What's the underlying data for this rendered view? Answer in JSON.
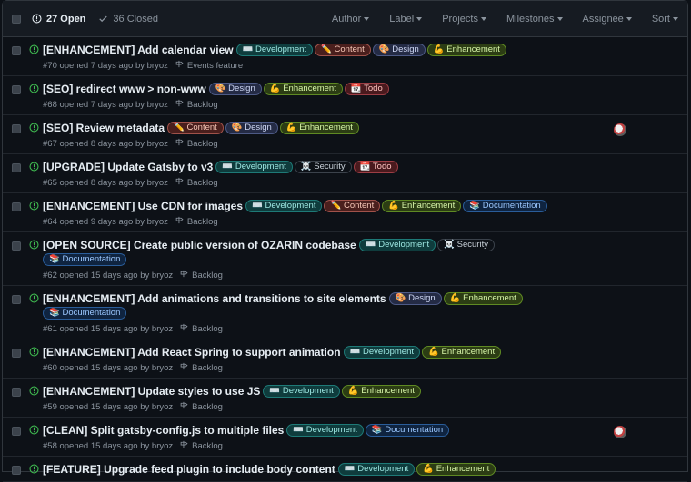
{
  "header": {
    "open_label": "27 Open",
    "closed_label": "36 Closed",
    "filters": [
      "Author",
      "Label",
      "Projects",
      "Milestones",
      "Assignee",
      "Sort"
    ]
  },
  "issues": [
    {
      "title": "[ENHANCEMENT] Add calendar view",
      "meta": "#70 opened 7 days ago by bryoz",
      "milestone": "Events feature",
      "labels": [
        [
          "development",
          "⌨️ Development"
        ],
        [
          "content",
          "✏️ Content"
        ],
        [
          "design",
          "🎨 Design"
        ],
        [
          "enhancement",
          "💪 Enhancement"
        ]
      ],
      "avatar": false
    },
    {
      "title": "[SEO] redirect www > non-www",
      "meta": "#68 opened 7 days ago by bryoz",
      "milestone": "Backlog",
      "labels": [
        [
          "design",
          "🎨 Design"
        ],
        [
          "enhancement",
          "💪 Enhancement"
        ],
        [
          "todo",
          "📆 Todo"
        ]
      ],
      "avatar": false
    },
    {
      "title": "[SEO] Review metadata",
      "meta": "#67 opened 8 days ago by bryoz",
      "milestone": "Backlog",
      "labels": [
        [
          "content",
          "✏️ Content"
        ],
        [
          "design",
          "🎨 Design"
        ],
        [
          "enhancement",
          "💪 Enhancement"
        ]
      ],
      "avatar": true
    },
    {
      "title": "[UPGRADE] Update Gatsby to v3",
      "meta": "#65 opened 8 days ago by bryoz",
      "milestone": "Backlog",
      "labels": [
        [
          "development",
          "⌨️ Development"
        ],
        [
          "security",
          "☠️ Security"
        ],
        [
          "todo",
          "📆 Todo"
        ]
      ],
      "avatar": false
    },
    {
      "title": "[ENHANCEMENT] Use CDN for images",
      "meta": "#64 opened 9 days ago by bryoz",
      "milestone": "Backlog",
      "labels": [
        [
          "development",
          "⌨️ Development"
        ],
        [
          "content",
          "✏️ Content"
        ],
        [
          "enhancement",
          "💪 Enhancement"
        ],
        [
          "documentation",
          "📚 Documentation"
        ]
      ],
      "avatar": false
    },
    {
      "title": "[OPEN SOURCE] Create public version of OZARIN codebase",
      "meta": "#62 opened 15 days ago by bryoz",
      "milestone": "Backlog",
      "labels": [
        [
          "development",
          "⌨️ Development"
        ],
        [
          "security",
          "☠️ Security"
        ],
        [
          "documentation",
          "📚 Documentation"
        ]
      ],
      "avatar": false
    },
    {
      "title": "[ENHANCEMENT] Add animations and transitions to site elements",
      "meta": "#61 opened 15 days ago by bryoz",
      "milestone": "Backlog",
      "labels": [
        [
          "design",
          "🎨 Design"
        ],
        [
          "enhancement",
          "💪 Enhancement"
        ],
        [
          "documentation",
          "📚 Documentation"
        ]
      ],
      "avatar": false
    },
    {
      "title": "[ENHANCEMENT] Add React Spring to support animation",
      "meta": "#60 opened 15 days ago by bryoz",
      "milestone": "Backlog",
      "labels": [
        [
          "development",
          "⌨️ Development"
        ],
        [
          "enhancement",
          "💪 Enhancement"
        ]
      ],
      "avatar": false
    },
    {
      "title": "[ENHANCEMENT] Update styles to use JS",
      "meta": "#59 opened 15 days ago by bryoz",
      "milestone": "Backlog",
      "labels": [
        [
          "development",
          "⌨️ Development"
        ],
        [
          "enhancement",
          "💪 Enhancement"
        ]
      ],
      "avatar": false
    },
    {
      "title": "[CLEAN] Split gatsby-config.js to multiple files",
      "meta": "#58 opened 15 days ago by bryoz",
      "milestone": "Backlog",
      "labels": [
        [
          "development",
          "⌨️ Development"
        ],
        [
          "documentation",
          "📚 Documentation"
        ]
      ],
      "avatar": true
    },
    {
      "title": "[FEATURE] Upgrade feed plugin to include body content",
      "meta": "",
      "milestone": "",
      "labels": [
        [
          "development",
          "⌨️ Development"
        ],
        [
          "enhancement",
          "💪 Enhancement"
        ]
      ],
      "avatar": false
    }
  ],
  "colors": {
    "open_icon": "#3fb950",
    "background": "#0d1117",
    "header_bg": "#161b22"
  }
}
